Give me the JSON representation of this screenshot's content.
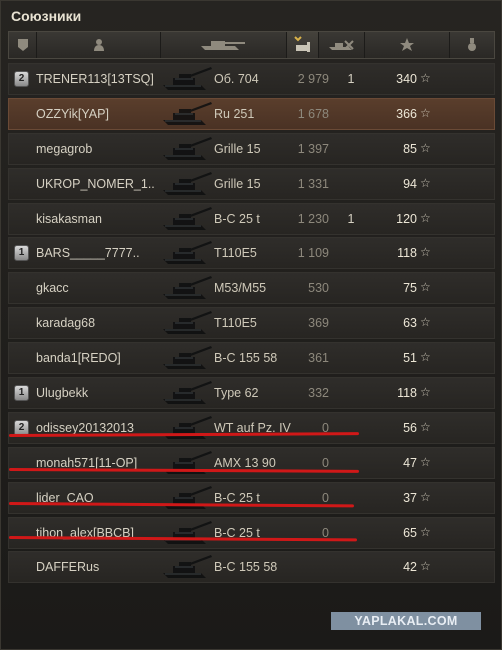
{
  "window": {
    "title": "Союзники"
  },
  "columns": [
    {
      "name": "rank-column",
      "icon": "rank-badge-icon",
      "active": false
    },
    {
      "name": "player-column",
      "icon": "player-icon",
      "active": false
    },
    {
      "name": "vehicle-column",
      "icon": "tank-icon",
      "active": false
    },
    {
      "name": "damage-column",
      "icon": "damage-icon",
      "active": true
    },
    {
      "name": "frags-column",
      "icon": "destroyed-tank-icon",
      "active": false
    },
    {
      "name": "xp-column",
      "icon": "star-icon",
      "active": false
    },
    {
      "name": "medal-column",
      "icon": "medal-icon",
      "active": false
    }
  ],
  "rows": [
    {
      "badge": "2",
      "player": "TRENER113[13TSQ]",
      "vehicle": "Об. 704",
      "damage": "2 979",
      "frags": "1",
      "xp": "340",
      "highlight": false
    },
    {
      "badge": "",
      "player": "OZZYik[YAP]",
      "vehicle": "Ru 251",
      "damage": "1 678",
      "frags": "",
      "xp": "366",
      "highlight": true
    },
    {
      "badge": "",
      "player": "megagrob",
      "vehicle": "Grille 15",
      "damage": "1 397",
      "frags": "",
      "xp": "85",
      "highlight": false
    },
    {
      "badge": "",
      "player": "UKROP_NOMER_1..",
      "vehicle": "Grille 15",
      "damage": "1 331",
      "frags": "",
      "xp": "94",
      "highlight": false
    },
    {
      "badge": "",
      "player": "kisakasman",
      "vehicle": "B-C 25 t",
      "damage": "1 230",
      "frags": "1",
      "xp": "120",
      "highlight": false
    },
    {
      "badge": "1",
      "player": "BARS_____7777..",
      "vehicle": "T110E5",
      "damage": "1 109",
      "frags": "",
      "xp": "118",
      "highlight": false
    },
    {
      "badge": "",
      "player": "gkacc",
      "vehicle": "M53/M55",
      "damage": "530",
      "frags": "",
      "xp": "75",
      "highlight": false
    },
    {
      "badge": "",
      "player": "karadag68",
      "vehicle": "T110E5",
      "damage": "369",
      "frags": "",
      "xp": "63",
      "highlight": false
    },
    {
      "badge": "",
      "player": "banda1[REDO]",
      "vehicle": "B-C 155 58",
      "damage": "361",
      "frags": "",
      "xp": "51",
      "highlight": false
    },
    {
      "badge": "1",
      "player": "Ulugbekk",
      "vehicle": "Type 62",
      "damage": "332",
      "frags": "",
      "xp": "118",
      "highlight": false
    },
    {
      "badge": "2",
      "player": "odissey20132013",
      "vehicle": "WT auf Pz. IV",
      "damage": "0",
      "frags": "",
      "xp": "56",
      "highlight": false
    },
    {
      "badge": "",
      "player": "monah571[11-OP]",
      "vehicle": "AMX 13 90",
      "damage": "0",
      "frags": "",
      "xp": "47",
      "highlight": false
    },
    {
      "badge": "",
      "player": "lider_CAO",
      "vehicle": "B-C 25 t",
      "damage": "0",
      "frags": "",
      "xp": "37",
      "highlight": false
    },
    {
      "badge": "",
      "player": "tihon_alex[BBCB]",
      "vehicle": "B-C 25 t",
      "damage": "0",
      "frags": "",
      "xp": "65",
      "highlight": false
    },
    {
      "badge": "",
      "player": "DAFFERus",
      "vehicle": "B-C 155 58",
      "damage": "",
      "frags": "",
      "xp": "42",
      "highlight": false
    }
  ],
  "watermark": "YAPLAKAL.COM",
  "colors": {
    "annotation_line": "#d01818",
    "highlight_row": "#5a3e2c",
    "watermark_bg": "#7f90a1"
  }
}
